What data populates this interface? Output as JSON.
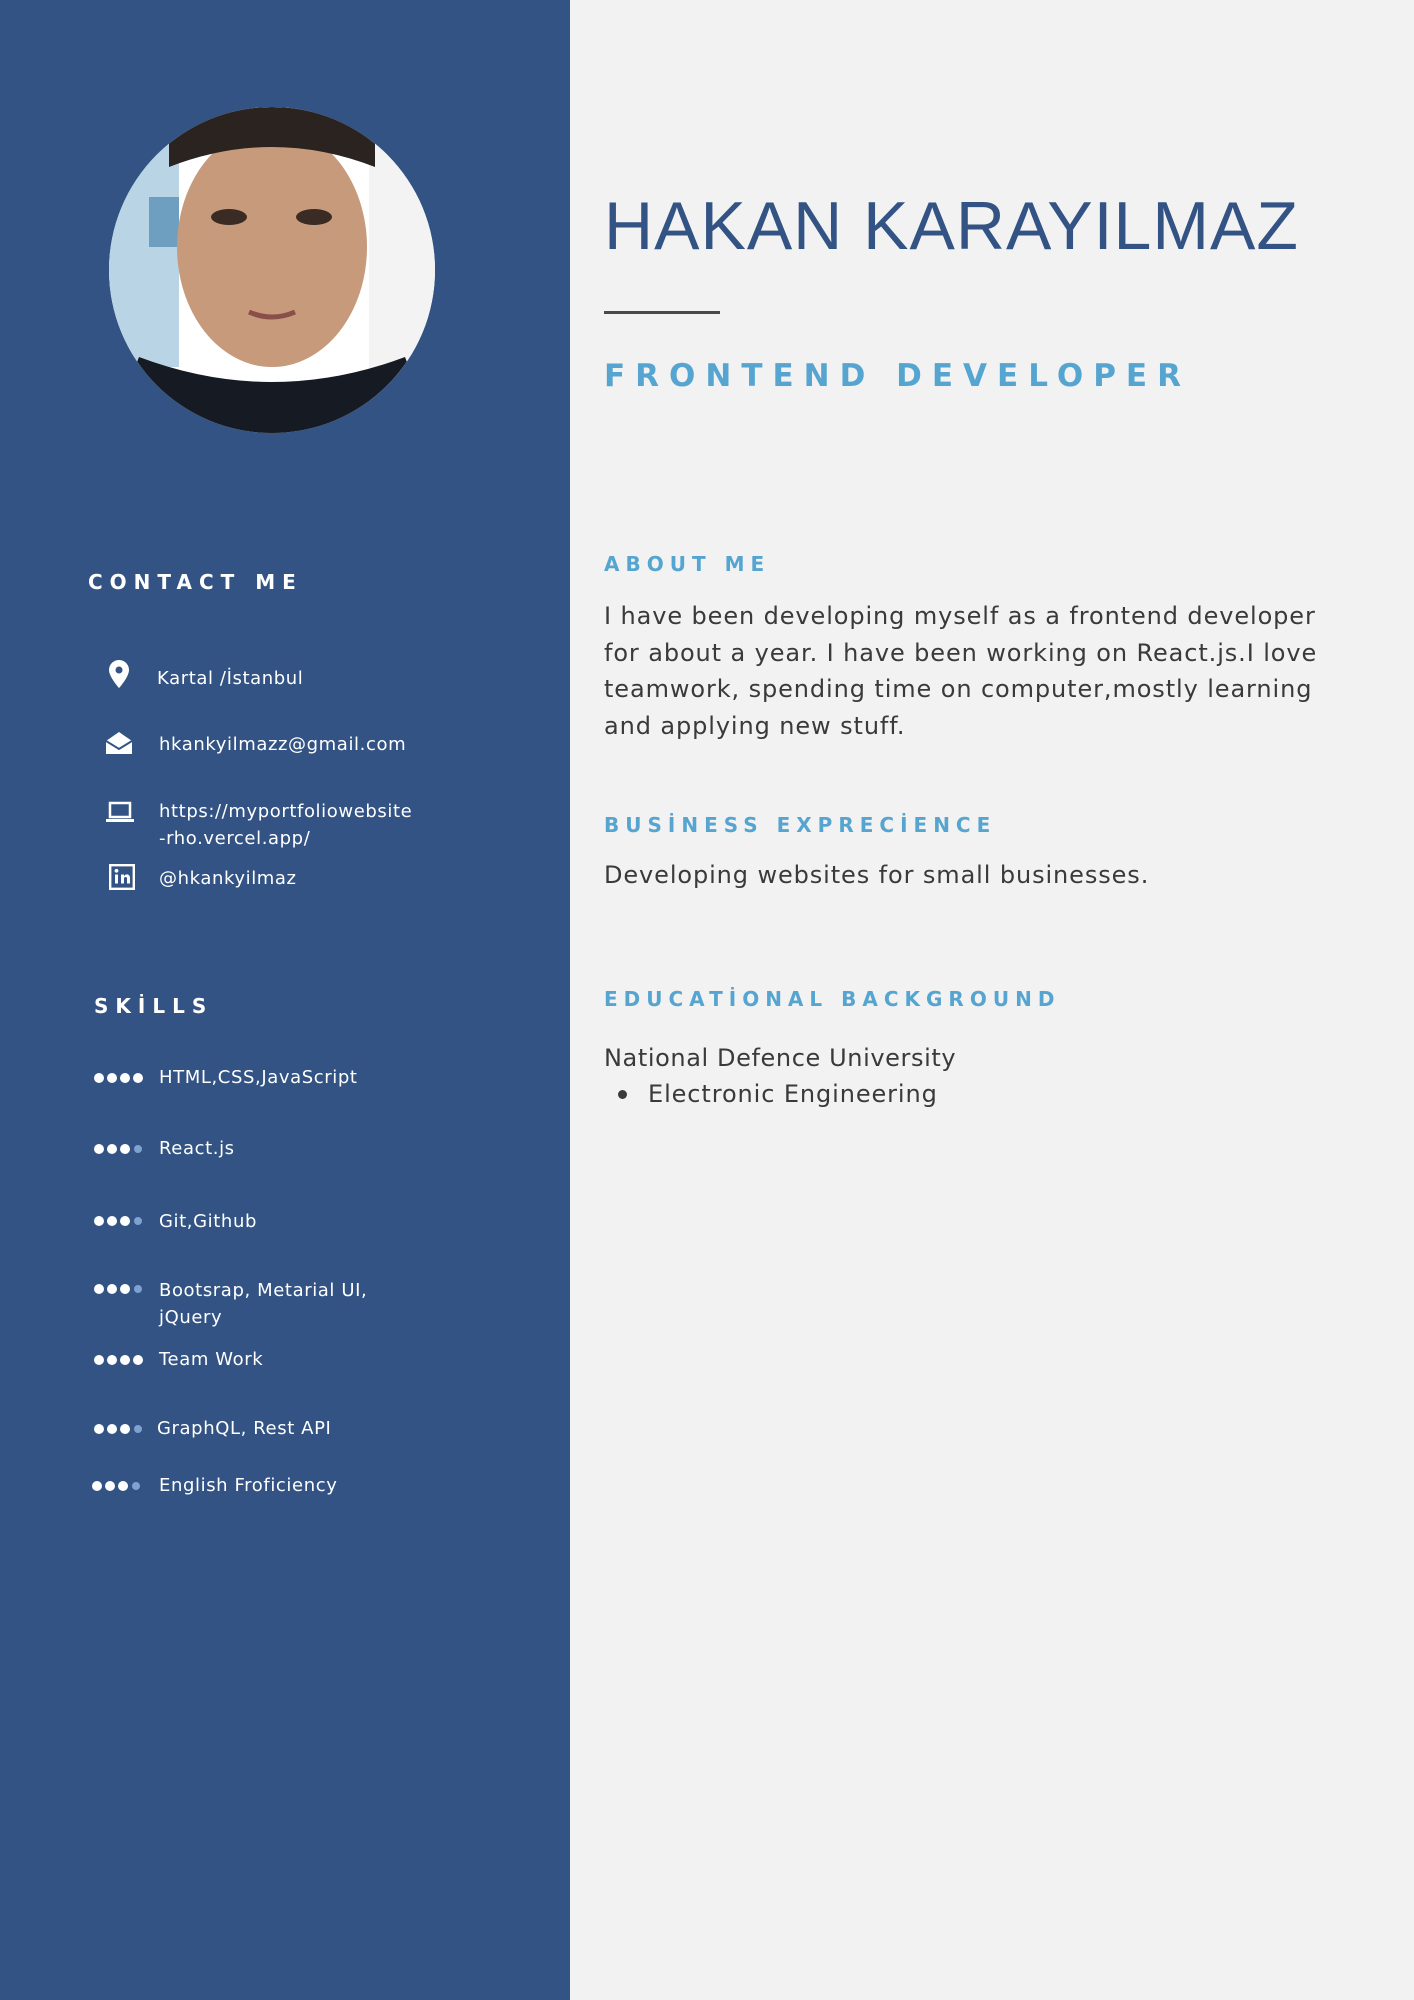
{
  "profile": {
    "name": "HAKAN KARAYILMAZ",
    "role": "FRONTEND DEVELOPER",
    "photo_alt": "profile photo"
  },
  "contact": {
    "heading": "CONTACT ME",
    "items": [
      {
        "icon": "map-pin-icon",
        "text": "Kartal /İstanbul"
      },
      {
        "icon": "envelope-icon",
        "text": "hkankyilmazz@gmail.com"
      },
      {
        "icon": "laptop-icon",
        "text_line1": "https://myportfoliowebsite",
        "text_line2": "-rho.vercel.app/"
      },
      {
        "icon": "linkedin-icon",
        "text": "@hkankyilmaz"
      }
    ]
  },
  "skills": {
    "heading": "SKİLLS",
    "items": [
      {
        "label": "HTML,CSS,JavaScript",
        "level": 4,
        "max": 4
      },
      {
        "label": "React.js",
        "level": 3,
        "max": 4
      },
      {
        "label": "Git,Github",
        "level": 3,
        "max": 4
      },
      {
        "label_line1": "Bootsrap, Metarial UI,",
        "label_line2": "jQuery",
        "level": 3,
        "max": 4
      },
      {
        "label": "Team Work",
        "level": 4,
        "max": 4
      },
      {
        "label": "GraphQL, Rest API",
        "level": 3,
        "max": 4
      },
      {
        "label": "English Froficiency",
        "level": 3,
        "max": 4
      }
    ]
  },
  "about": {
    "heading": "ABOUT ME",
    "lines": [
      "I have been developing myself as a frontend developer",
      "for about a year. I have been working on React.js.I love",
      "teamwork, spending time on computer,mostly learning",
      "and applying new stuff."
    ]
  },
  "business": {
    "heading": "BUSİNESS EXPRECİENCE",
    "text": "Developing websites for small businesses."
  },
  "education": {
    "heading": "EDUCATİONAL BACKGROUND",
    "school": "National Defence University",
    "items": [
      "Electronic Engineering"
    ]
  },
  "colors": {
    "sidebar": "#325383",
    "page": "#f2f2f2",
    "accent": "#56a5d0",
    "name": "#325383",
    "body_text": "#3a3a3a",
    "skill_dot_on": "#ffffff",
    "skill_dot_off": "#7ea2cf"
  }
}
